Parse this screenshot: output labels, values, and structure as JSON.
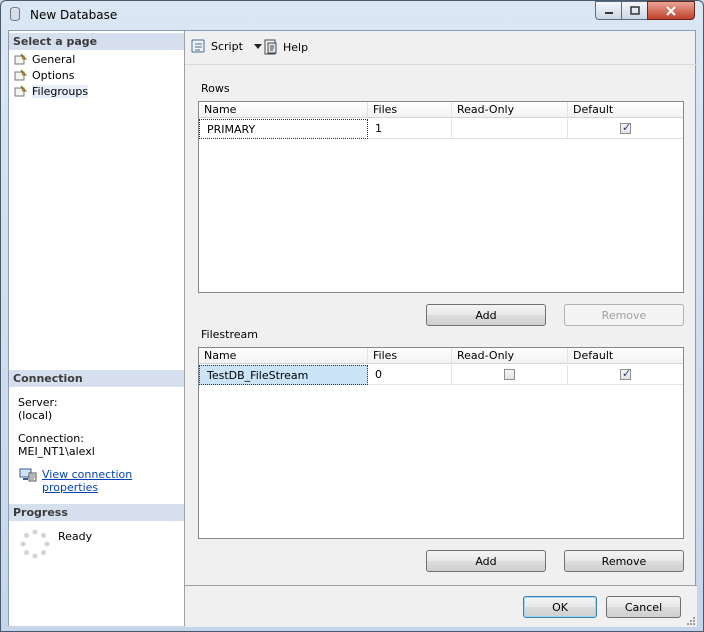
{
  "window": {
    "title": "New Database",
    "controls": [
      "minimize-icon",
      "maximize-icon",
      "close-icon"
    ]
  },
  "left": {
    "select_page_header": "Select a page",
    "pages": [
      {
        "label": "General",
        "icon": "page-icon"
      },
      {
        "label": "Options",
        "icon": "page-icon"
      },
      {
        "label": "Filegroups",
        "icon": "page-icon",
        "selected": true
      }
    ],
    "connection_header": "Connection",
    "server_label": "Server:",
    "server_value": "(local)",
    "connection_label": "Connection:",
    "connection_value": "MEI_NT1\\alexl",
    "view_link": "View connection properties",
    "progress_header": "Progress",
    "progress_status": "Ready"
  },
  "toolbar": {
    "script_label": "Script",
    "help_label": "Help"
  },
  "rows": {
    "group_label": "Rows",
    "columns": [
      "Name",
      "Files",
      "Read-Only",
      "Default"
    ],
    "data": [
      {
        "name": "PRIMARY",
        "files": "1",
        "read_only": null,
        "default": true
      }
    ],
    "add_label": "Add",
    "remove_label": "Remove"
  },
  "filestream": {
    "group_label": "Filestream",
    "columns": [
      "Name",
      "Files",
      "Read-Only",
      "Default"
    ],
    "data": [
      {
        "name": "TestDB_FileStream",
        "files": "0",
        "read_only": false,
        "default": true
      }
    ],
    "add_label": "Add",
    "remove_label": "Remove"
  },
  "footer": {
    "ok_label": "OK",
    "cancel_label": "Cancel"
  }
}
